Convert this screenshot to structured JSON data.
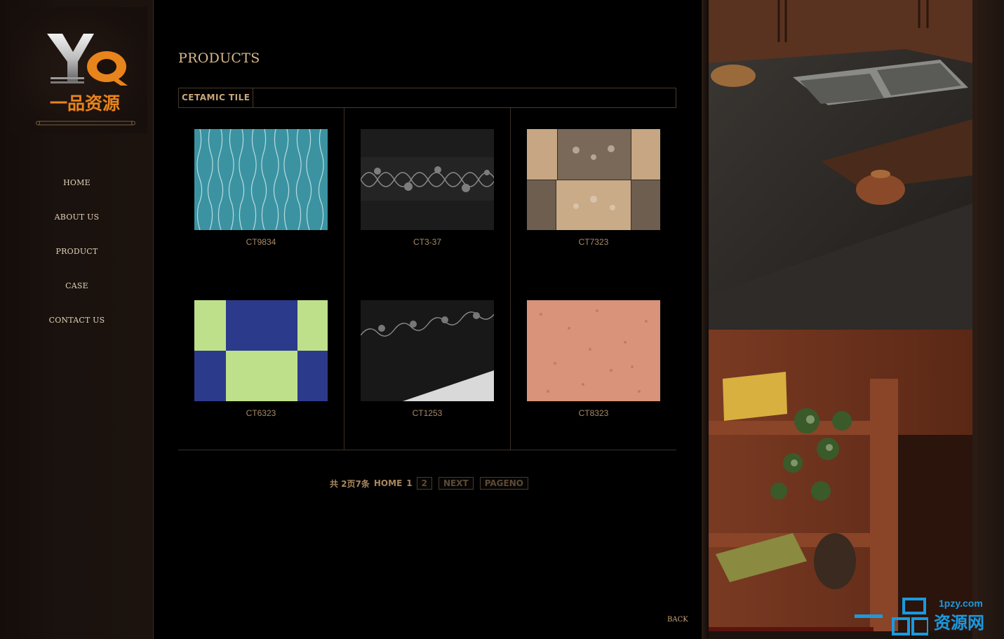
{
  "logo": {
    "mark": "YQ",
    "cn_name": "一品资源"
  },
  "nav": {
    "items": [
      {
        "label": "HOME"
      },
      {
        "label": "ABOUT US"
      },
      {
        "label": "PRODUCT"
      },
      {
        "label": "CASE"
      },
      {
        "label": "CONTACT US"
      }
    ]
  },
  "main": {
    "title": "PRODUCTS",
    "category": "CETAMIC TILE",
    "products": [
      {
        "code": "CT9834",
        "icon": "blue-wavy-tile-image"
      },
      {
        "code": "CT3-37",
        "icon": "black-floral-border-tile-image"
      },
      {
        "code": "CT7323",
        "icon": "beige-brown-patchwork-tile-image"
      },
      {
        "code": "CT6323",
        "icon": "green-blue-checker-tile-image"
      },
      {
        "code": "CT1253",
        "icon": "black-floral-floor-tile-image"
      },
      {
        "code": "CT8323",
        "icon": "pink-granite-tile-image"
      }
    ],
    "pager": {
      "summary": "共 2页7条",
      "home": "HOME",
      "current": "1",
      "page2": "2",
      "next": "NEXT",
      "pageno": "PAGENO"
    },
    "back": "BACK"
  },
  "watermark": {
    "url": "1pzy.com",
    "cn": "资源网"
  },
  "colors": {
    "accent": "#c9a77a",
    "logo_orange": "#e8841c",
    "border": "#4a3a2a",
    "watermark_blue": "#1a9ae0"
  }
}
